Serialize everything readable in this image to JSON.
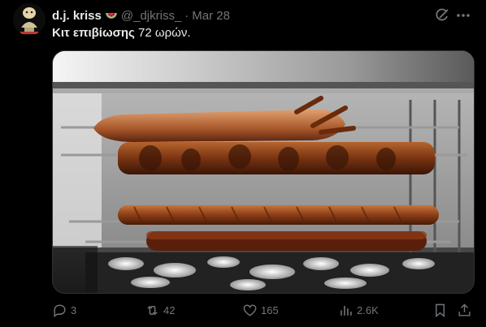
{
  "tweet": {
    "display_name": "d.j. kriss",
    "handle": "@_djkriss_",
    "separator": "·",
    "date": "Mar 28",
    "text_bold": "Κιτ επιβίωσης",
    "text_rest": " 72 ωρών."
  },
  "icons": {
    "badge_emoji": "watermelon-icon",
    "grok": "grok-icon",
    "more": "more-icon"
  },
  "actions": {
    "replies": "3",
    "reposts": "42",
    "likes": "165",
    "views": "2.6K"
  }
}
